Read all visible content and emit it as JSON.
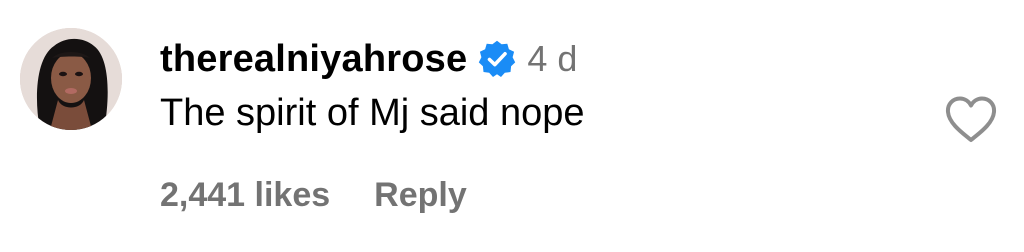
{
  "comment": {
    "username": "therealniyahrose",
    "timestamp": "4 d",
    "text": "The spirit of Mj said nope",
    "likes_label": "2,441 likes",
    "reply_label": "Reply"
  },
  "icons": {
    "verified": "verified-badge-icon",
    "like": "heart-outline-icon",
    "avatar": "profile-photo"
  },
  "colors": {
    "verified_blue": "#1a8cf6",
    "muted_text": "#737373",
    "heart_stroke": "#8e8e8e"
  }
}
